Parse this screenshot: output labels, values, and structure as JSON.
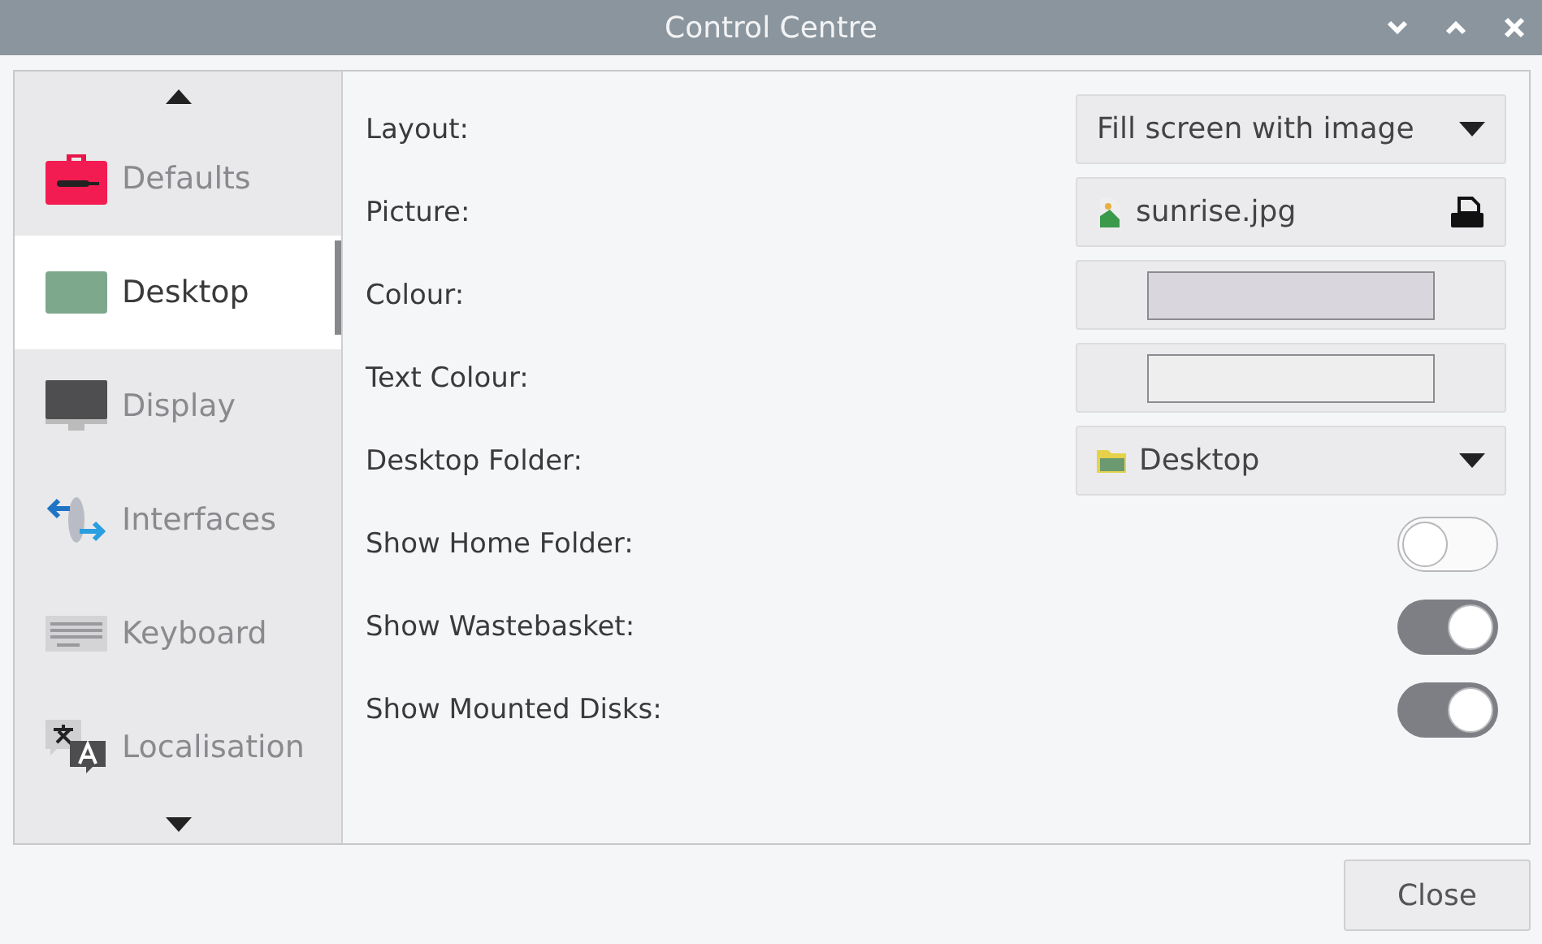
{
  "window": {
    "title": "Control Centre"
  },
  "sidebar": {
    "items": [
      {
        "label": "Defaults",
        "selected": false
      },
      {
        "label": "Desktop",
        "selected": true
      },
      {
        "label": "Display",
        "selected": false
      },
      {
        "label": "Interfaces",
        "selected": false
      },
      {
        "label": "Keyboard",
        "selected": false
      },
      {
        "label": "Localisation",
        "selected": false
      }
    ]
  },
  "settings": [
    {
      "kind": "dropdown",
      "label": "Layout:",
      "value": "Fill screen with image"
    },
    {
      "kind": "file",
      "label": "Picture:",
      "value": "sunrise.jpg"
    },
    {
      "kind": "colour",
      "label": "Colour:",
      "color": "#d9d7dd"
    },
    {
      "kind": "colour",
      "label": "Text Colour:",
      "color": "#eeeeee"
    },
    {
      "kind": "folder",
      "label": "Desktop Folder:",
      "value": "Desktop"
    },
    {
      "kind": "toggle",
      "label": "Show Home Folder:",
      "on": false
    },
    {
      "kind": "toggle",
      "label": "Show Wastebasket:",
      "on": true
    },
    {
      "kind": "toggle",
      "label": "Show Mounted Disks:",
      "on": true
    }
  ],
  "buttons": [
    "Close"
  ]
}
